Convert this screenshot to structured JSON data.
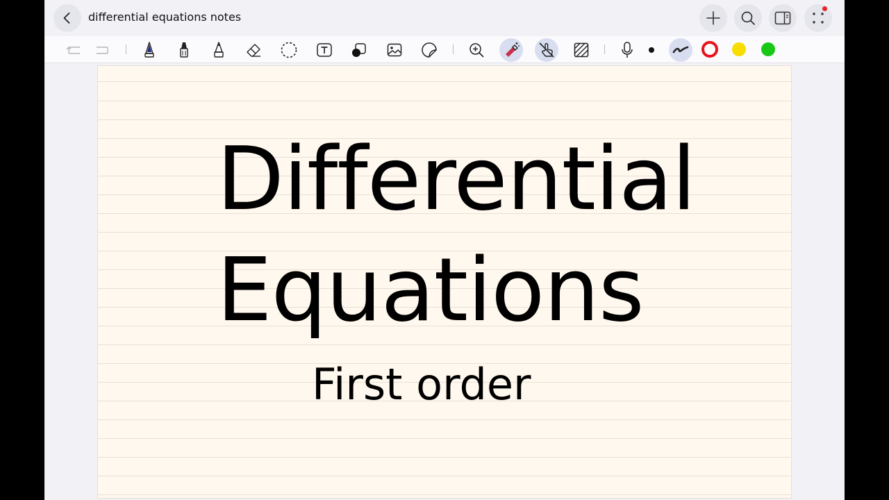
{
  "header": {
    "title": "differential equations notes"
  },
  "toolbar": {
    "tools": [
      {
        "name": "undo-icon"
      },
      {
        "name": "redo-icon"
      },
      {
        "name": "fountain-pen-icon",
        "color": "#1f2a80"
      },
      {
        "name": "marker-pen-icon"
      },
      {
        "name": "pencil-icon"
      },
      {
        "name": "eraser-icon"
      },
      {
        "name": "lasso-select-icon"
      },
      {
        "name": "text-box-icon"
      },
      {
        "name": "shapes-icon"
      },
      {
        "name": "image-icon"
      },
      {
        "name": "sticker-icon"
      },
      {
        "name": "zoom-in-icon"
      },
      {
        "name": "magic-eraser-icon",
        "active": true
      },
      {
        "name": "touch-draw-icon",
        "active": true
      },
      {
        "name": "hatch-fill-icon"
      },
      {
        "name": "microphone-icon"
      },
      {
        "name": "brush-size-dot-icon"
      },
      {
        "name": "stroke-style-icon",
        "active": true
      }
    ],
    "colors": [
      {
        "name": "red",
        "hex": "#e8141a",
        "selected": true
      },
      {
        "name": "yellow",
        "hex": "#f7de00",
        "selected": false
      },
      {
        "name": "green",
        "hex": "#19c816",
        "selected": false
      }
    ]
  },
  "page": {
    "line1": "Differential",
    "line2": "Equations",
    "line3": "First order"
  }
}
